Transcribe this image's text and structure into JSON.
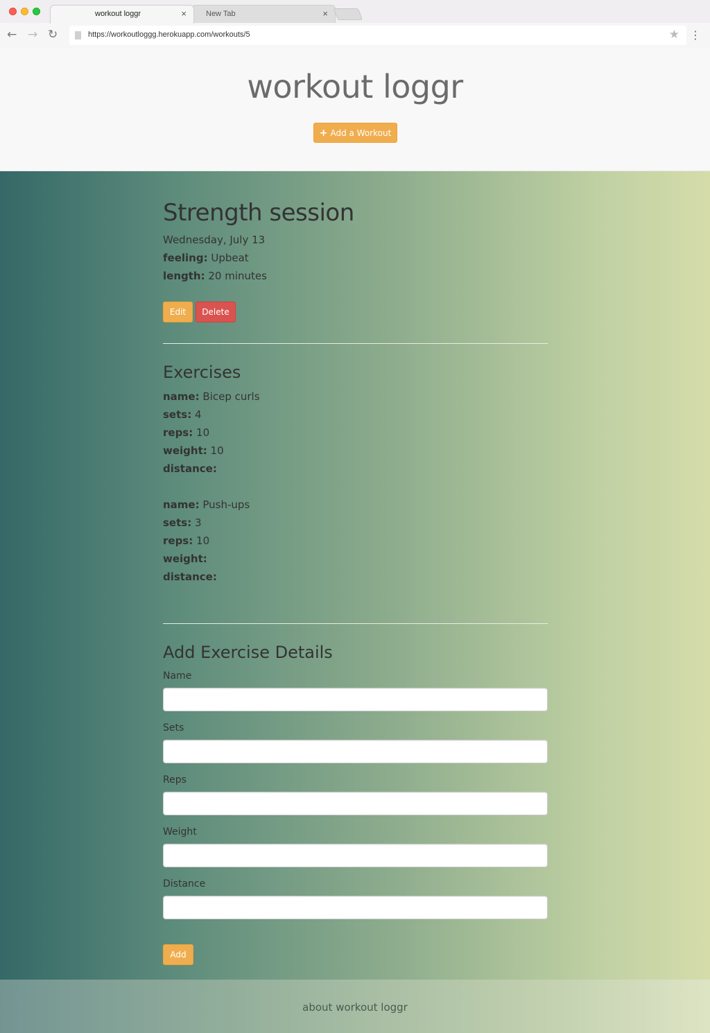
{
  "browser": {
    "tabs": [
      {
        "title": "workout loggr",
        "close": "×"
      },
      {
        "title": "New Tab",
        "close": "×"
      }
    ],
    "url": "https://workoutloggg.herokuapp.com/workouts/5",
    "icons": {
      "back": "←",
      "forward": "→",
      "reload": "↻",
      "star": "★",
      "menu": "⋮"
    }
  },
  "header": {
    "site_title": "workout loggr",
    "add_workout_label": "Add a Workout",
    "add_icon": "+"
  },
  "workout": {
    "title": "Strength session",
    "date": "Wednesday, July 13",
    "feeling_label": "feeling:",
    "feeling_value": "Upbeat",
    "length_label": "length:",
    "length_value": "20 minutes",
    "edit_label": "Edit",
    "delete_label": "Delete"
  },
  "exercises": {
    "heading": "Exercises",
    "items": [
      {
        "name_label": "name:",
        "name": "Bicep curls",
        "sets_label": "sets:",
        "sets": "4",
        "reps_label": "reps:",
        "reps": "10",
        "weight_label": "weight:",
        "weight": "10",
        "distance_label": "distance:",
        "distance": ""
      },
      {
        "name_label": "name:",
        "name": "Push-ups",
        "sets_label": "sets:",
        "sets": "3",
        "reps_label": "reps:",
        "reps": "10",
        "weight_label": "weight:",
        "weight": "",
        "distance_label": "distance:",
        "distance": ""
      }
    ]
  },
  "form": {
    "heading": "Add Exercise Details",
    "fields": [
      {
        "label": "Name",
        "value": ""
      },
      {
        "label": "Sets",
        "value": ""
      },
      {
        "label": "Reps",
        "value": ""
      },
      {
        "label": "Weight",
        "value": ""
      },
      {
        "label": "Distance",
        "value": ""
      }
    ],
    "submit_label": "Add"
  },
  "footer": {
    "link": "about workout loggr"
  },
  "colors": {
    "accent": "#f0ad4e",
    "danger": "#d9534f"
  }
}
